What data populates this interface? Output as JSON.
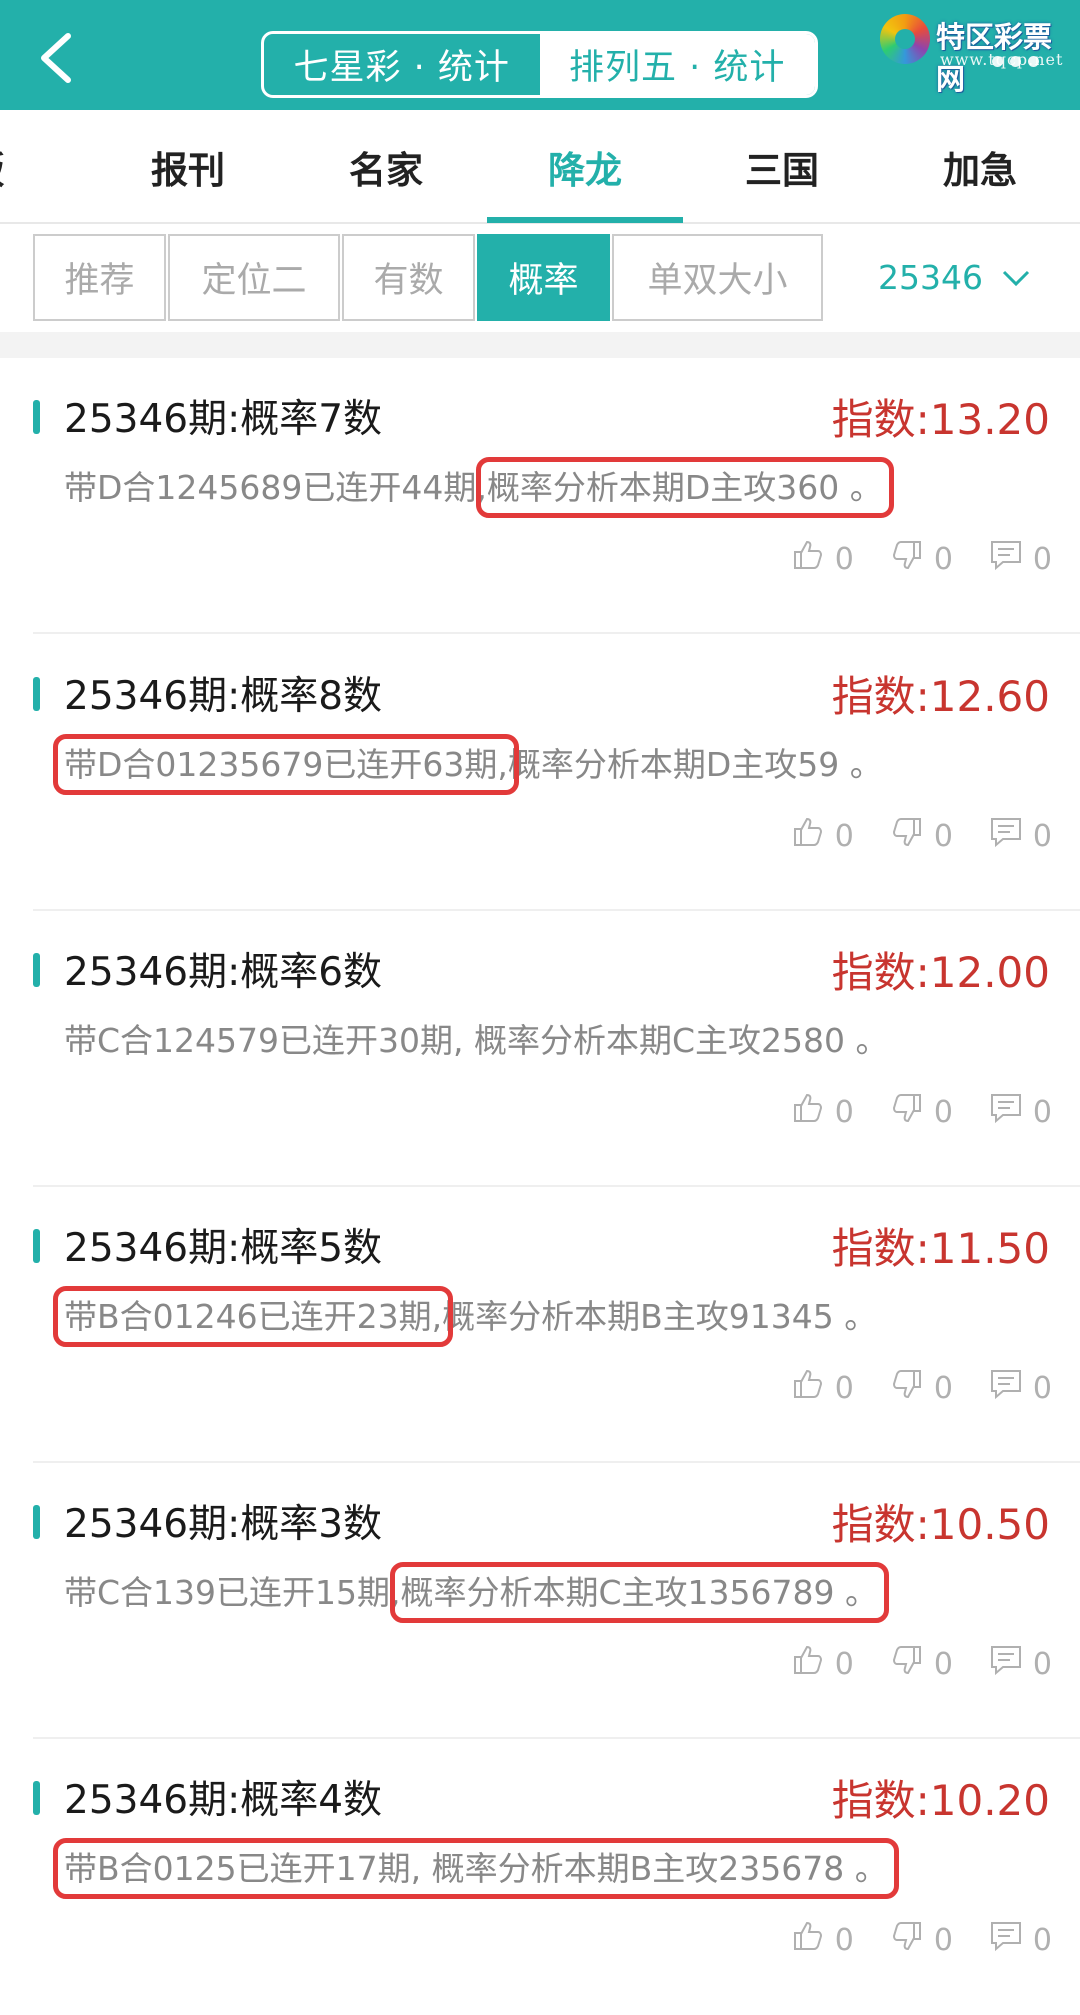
{
  "header": {
    "tabs": [
      {
        "label": "七星彩 · 统计",
        "active": false
      },
      {
        "label": "排列五 · 统计",
        "active": true
      }
    ],
    "logo_text": "特区彩票网",
    "logo_url": "www.tqcp.net"
  },
  "nav": {
    "items": [
      "版",
      "报刊",
      "名家",
      "降龙",
      "三国",
      "加急"
    ],
    "active_index": 3
  },
  "subtabs": {
    "items": [
      "推荐",
      "定位二",
      "有数",
      "概率",
      "单双大小"
    ],
    "active_index": 3
  },
  "issue_selector": {
    "value": "25346"
  },
  "colors": {
    "accent": "#23b0aa",
    "index_red": "#c8352f",
    "highlight_box": "#e23a3a"
  },
  "posts": [
    {
      "title": "25346期:概率7数",
      "index": "指数:13.20",
      "desc_pre": "带D合1245689已连开44期,",
      "desc_hl": "概率分析本期D主攻360 。",
      "desc_post": "",
      "likes": "0",
      "dislikes": "0",
      "comments": "0"
    },
    {
      "title": "25346期:概率8数",
      "index": "指数:12.60",
      "desc_pre": "",
      "desc_hl": "带D合01235679已连开63期,",
      "desc_post": "概率分析本期D主攻59 。",
      "likes": "0",
      "dislikes": "0",
      "comments": "0"
    },
    {
      "title": "25346期:概率6数",
      "index": "指数:12.00",
      "desc_pre": "带C合124579已连开30期, 概率分析本期C主攻2580 。",
      "desc_hl": "",
      "desc_post": "",
      "likes": "0",
      "dislikes": "0",
      "comments": "0"
    },
    {
      "title": "25346期:概率5数",
      "index": "指数:11.50",
      "desc_pre": "",
      "desc_hl": "带B合01246已连开23期,",
      "desc_post": "概率分析本期B主攻91345 。",
      "likes": "0",
      "dislikes": "0",
      "comments": "0"
    },
    {
      "title": "25346期:概率3数",
      "index": "指数:10.50",
      "desc_pre": "带C合139已连开15期,",
      "desc_hl": "概率分析本期C主攻1356789 。",
      "desc_post": "",
      "likes": "0",
      "dislikes": "0",
      "comments": "0"
    },
    {
      "title": "25346期:概率4数",
      "index": "指数:10.20",
      "desc_pre": "",
      "desc_hl": "带B合0125已连开17期, 概率分析本期B主攻235678 。",
      "desc_post": "",
      "likes": "0",
      "dislikes": "0",
      "comments": "0"
    }
  ]
}
